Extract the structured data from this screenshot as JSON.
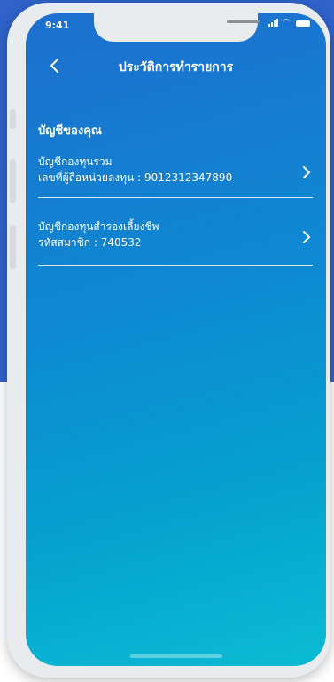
{
  "status_bar": {
    "time": "9:41"
  },
  "header": {
    "title": "ประวัติการทำรายการ"
  },
  "section": {
    "title": "บัญชีของคุณ"
  },
  "accounts": [
    {
      "name": "บัญชีกองทุนรวม",
      "detail": "เลขที่ผู้ถือหน่วยลงทุน : 9012312347890"
    },
    {
      "name": "บัญชีกองทุนสำรองเลี้ยงชีพ",
      "detail": "รหัสสมาชิก : 740532"
    }
  ],
  "icons": {
    "back": "chevron-left-icon",
    "forward": "chevron-right-icon"
  },
  "colors": {
    "outer_bg": "#2f63c9",
    "screen_top": "#1d6fcf",
    "screen_bottom": "#0bbcd3"
  }
}
